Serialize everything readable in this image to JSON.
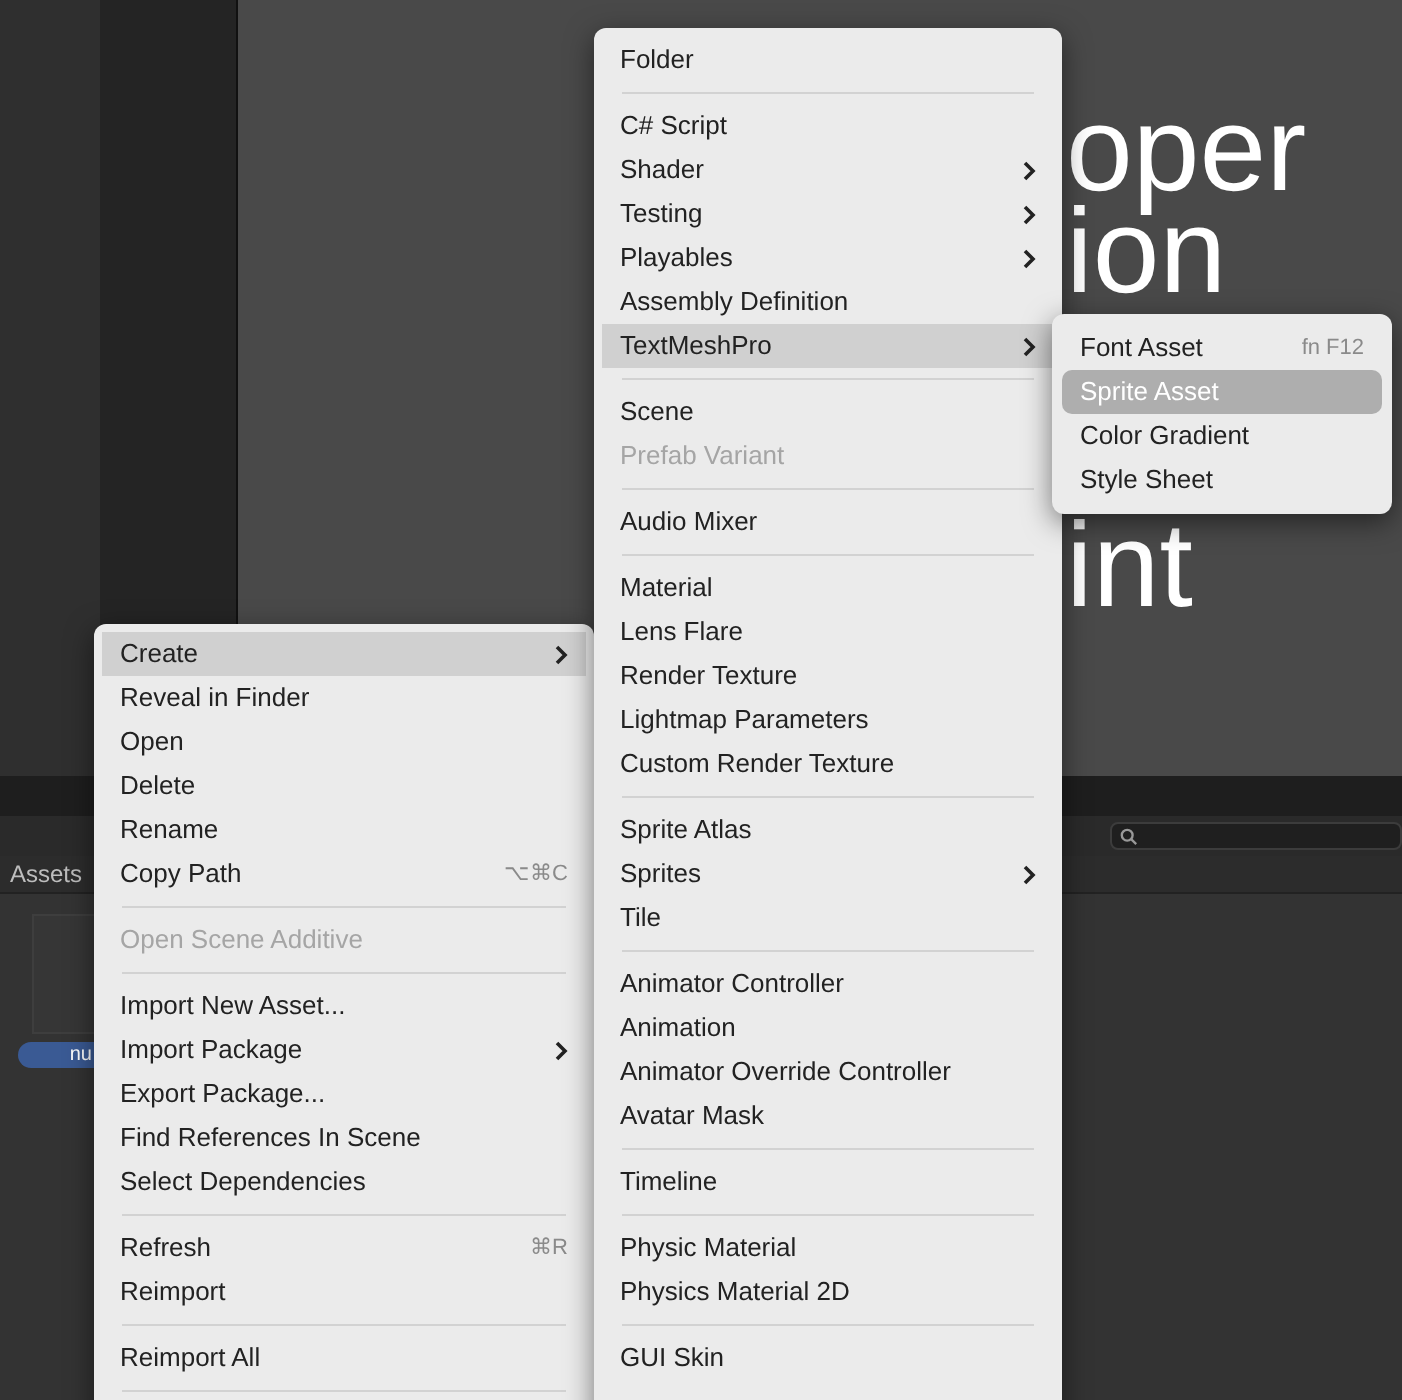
{
  "scene_text": [
    "oper",
    "ion",
    "int"
  ],
  "assets_panel": {
    "tab": "Assets",
    "asset_label": "nu"
  },
  "context_menu": {
    "items": [
      {
        "kind": "item",
        "label": "Create",
        "selected": true,
        "disabled": false,
        "submenu": true
      },
      {
        "kind": "item",
        "label": "Reveal in Finder",
        "selected": false,
        "disabled": false,
        "submenu": false
      },
      {
        "kind": "item",
        "label": "Open",
        "selected": false,
        "disabled": false,
        "submenu": false
      },
      {
        "kind": "item",
        "label": "Delete",
        "selected": false,
        "disabled": false,
        "submenu": false
      },
      {
        "kind": "item",
        "label": "Rename",
        "selected": false,
        "disabled": false,
        "submenu": false
      },
      {
        "kind": "item",
        "label": "Copy Path",
        "selected": false,
        "disabled": false,
        "submenu": false,
        "shortcut": "⌥⌘C"
      },
      {
        "kind": "separator"
      },
      {
        "kind": "item",
        "label": "Open Scene Additive",
        "selected": false,
        "disabled": true,
        "submenu": false
      },
      {
        "kind": "separator"
      },
      {
        "kind": "item",
        "label": "Import New Asset...",
        "selected": false,
        "disabled": false,
        "submenu": false
      },
      {
        "kind": "item",
        "label": "Import Package",
        "selected": false,
        "disabled": false,
        "submenu": true
      },
      {
        "kind": "item",
        "label": "Export Package...",
        "selected": false,
        "disabled": false,
        "submenu": false
      },
      {
        "kind": "item",
        "label": "Find References In Scene",
        "selected": false,
        "disabled": false,
        "submenu": false
      },
      {
        "kind": "item",
        "label": "Select Dependencies",
        "selected": false,
        "disabled": false,
        "submenu": false
      },
      {
        "kind": "separator"
      },
      {
        "kind": "item",
        "label": "Refresh",
        "selected": false,
        "disabled": false,
        "submenu": false,
        "shortcut": "⌘R"
      },
      {
        "kind": "item",
        "label": "Reimport",
        "selected": false,
        "disabled": false,
        "submenu": false
      },
      {
        "kind": "separator"
      },
      {
        "kind": "item",
        "label": "Reimport All",
        "selected": false,
        "disabled": false,
        "submenu": false
      },
      {
        "kind": "separator"
      }
    ]
  },
  "create_submenu": {
    "items": [
      {
        "kind": "item",
        "label": "Folder",
        "selected": false,
        "disabled": false,
        "submenu": false
      },
      {
        "kind": "separator"
      },
      {
        "kind": "item",
        "label": "C# Script",
        "selected": false,
        "disabled": false,
        "submenu": false
      },
      {
        "kind": "item",
        "label": "Shader",
        "selected": false,
        "disabled": false,
        "submenu": true
      },
      {
        "kind": "item",
        "label": "Testing",
        "selected": false,
        "disabled": false,
        "submenu": true
      },
      {
        "kind": "item",
        "label": "Playables",
        "selected": false,
        "disabled": false,
        "submenu": true
      },
      {
        "kind": "item",
        "label": "Assembly Definition",
        "selected": false,
        "disabled": false,
        "submenu": false
      },
      {
        "kind": "item",
        "label": "TextMeshPro",
        "selected": true,
        "disabled": false,
        "submenu": true
      },
      {
        "kind": "separator"
      },
      {
        "kind": "item",
        "label": "Scene",
        "selected": false,
        "disabled": false,
        "submenu": false
      },
      {
        "kind": "item",
        "label": "Prefab Variant",
        "selected": false,
        "disabled": true,
        "submenu": false
      },
      {
        "kind": "separator"
      },
      {
        "kind": "item",
        "label": "Audio Mixer",
        "selected": false,
        "disabled": false,
        "submenu": false
      },
      {
        "kind": "separator"
      },
      {
        "kind": "item",
        "label": "Material",
        "selected": false,
        "disabled": false,
        "submenu": false
      },
      {
        "kind": "item",
        "label": "Lens Flare",
        "selected": false,
        "disabled": false,
        "submenu": false
      },
      {
        "kind": "item",
        "label": "Render Texture",
        "selected": false,
        "disabled": false,
        "submenu": false
      },
      {
        "kind": "item",
        "label": "Lightmap Parameters",
        "selected": false,
        "disabled": false,
        "submenu": false
      },
      {
        "kind": "item",
        "label": "Custom Render Texture",
        "selected": false,
        "disabled": false,
        "submenu": false
      },
      {
        "kind": "separator"
      },
      {
        "kind": "item",
        "label": "Sprite Atlas",
        "selected": false,
        "disabled": false,
        "submenu": false
      },
      {
        "kind": "item",
        "label": "Sprites",
        "selected": false,
        "disabled": false,
        "submenu": true
      },
      {
        "kind": "item",
        "label": "Tile",
        "selected": false,
        "disabled": false,
        "submenu": false
      },
      {
        "kind": "separator"
      },
      {
        "kind": "item",
        "label": "Animator Controller",
        "selected": false,
        "disabled": false,
        "submenu": false
      },
      {
        "kind": "item",
        "label": "Animation",
        "selected": false,
        "disabled": false,
        "submenu": false
      },
      {
        "kind": "item",
        "label": "Animator Override Controller",
        "selected": false,
        "disabled": false,
        "submenu": false
      },
      {
        "kind": "item",
        "label": "Avatar Mask",
        "selected": false,
        "disabled": false,
        "submenu": false
      },
      {
        "kind": "separator"
      },
      {
        "kind": "item",
        "label": "Timeline",
        "selected": false,
        "disabled": false,
        "submenu": false
      },
      {
        "kind": "separator"
      },
      {
        "kind": "item",
        "label": "Physic Material",
        "selected": false,
        "disabled": false,
        "submenu": false
      },
      {
        "kind": "item",
        "label": "Physics Material 2D",
        "selected": false,
        "disabled": false,
        "submenu": false
      },
      {
        "kind": "separator"
      },
      {
        "kind": "item",
        "label": "GUI Skin",
        "selected": false,
        "disabled": false,
        "submenu": false
      }
    ]
  },
  "textmeshpro_submenu": {
    "items": [
      {
        "kind": "item",
        "label": "Font Asset",
        "selected": false,
        "disabled": false,
        "submenu": false,
        "shortcut": "fn F12"
      },
      {
        "kind": "item",
        "label": "Sprite Asset",
        "selected": true,
        "disabled": false,
        "submenu": false
      },
      {
        "kind": "item",
        "label": "Color Gradient",
        "selected": false,
        "disabled": false,
        "submenu": false
      },
      {
        "kind": "item",
        "label": "Style Sheet",
        "selected": false,
        "disabled": false,
        "submenu": false
      }
    ]
  }
}
